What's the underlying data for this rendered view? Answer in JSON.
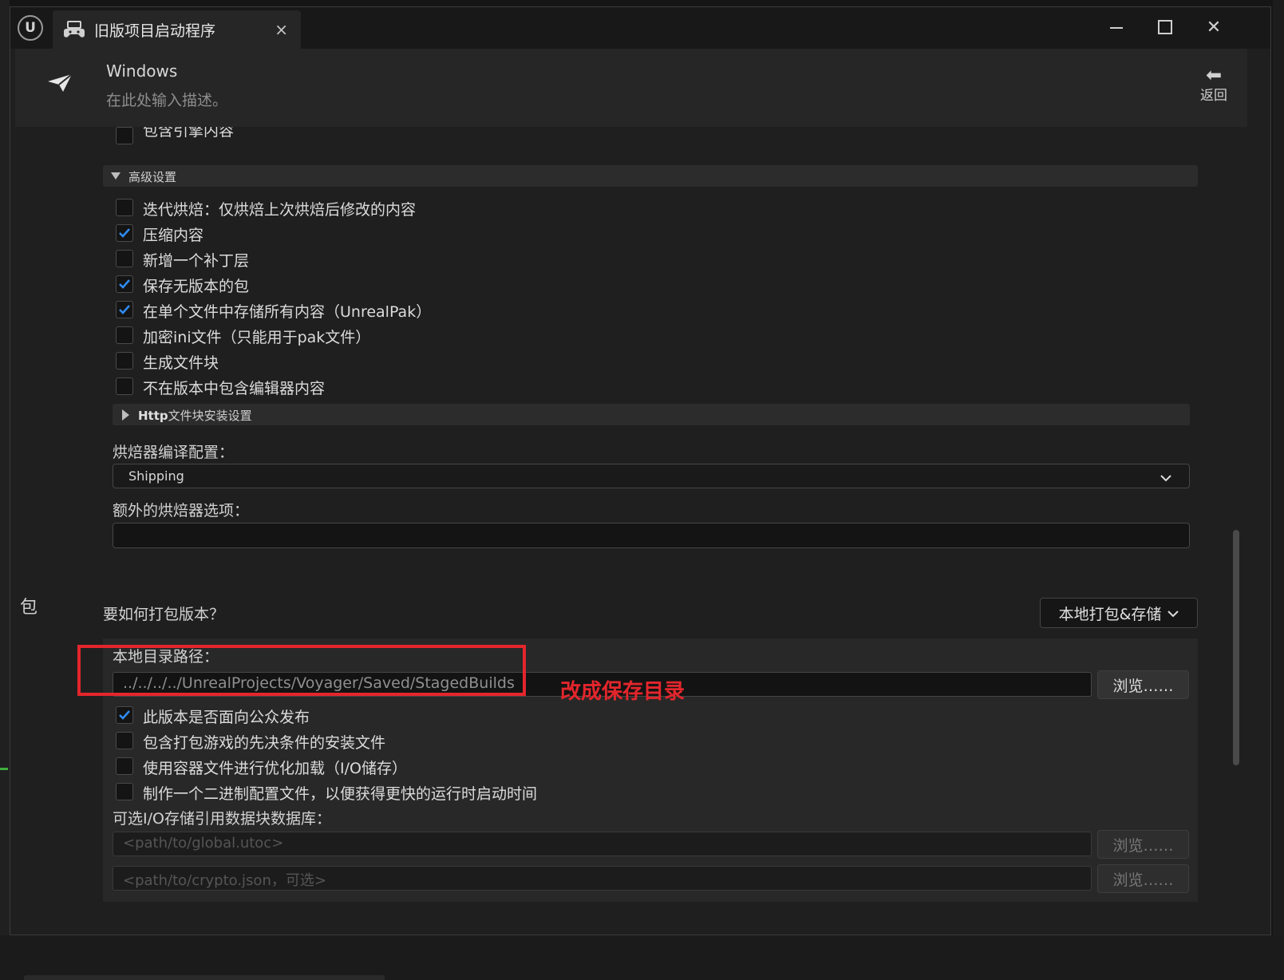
{
  "window": {
    "tab_title": "旧版项目启动程序",
    "tab_close": "×",
    "minimize": "—",
    "maximize": "☐",
    "close": "✕"
  },
  "header": {
    "platform": "Windows",
    "description": "在此处输入描述。",
    "back_label": "返回",
    "back_arrow": "⬅"
  },
  "cook": {
    "partial_item": "包含引擎内容",
    "advanced_label": "高级设置",
    "options": [
      {
        "label": "迭代烘焙：仅烘焙上次烘焙后修改的内容",
        "checked": false
      },
      {
        "label": "压缩内容",
        "checked": true
      },
      {
        "label": "新增一个补丁层",
        "checked": false
      },
      {
        "label": "保存无版本的包",
        "checked": true
      },
      {
        "label": "在单个文件中存储所有内容（UnrealPak）",
        "checked": true
      },
      {
        "label": "加密ini文件（只能用于pak文件）",
        "checked": false
      },
      {
        "label": "生成文件块",
        "checked": false
      },
      {
        "label": "不在版本中包含编辑器内容",
        "checked": false
      }
    ],
    "http_prefix": "Http",
    "http_label": "文件块安装设置",
    "cooker_config_label": "烘焙器编译配置：",
    "cooker_config_value": "Shipping",
    "extra_options_label": "额外的烘焙器选项："
  },
  "package": {
    "side_label": "包",
    "question": "要如何打包版本？",
    "mode": "本地打包&存储",
    "dir_label": "本地目录路径：",
    "dir_value": "../../../../UnrealProjects/Voyager/Saved/StagedBuilds",
    "browse": "浏览……",
    "options": [
      {
        "label": "此版本是否面向公众发布",
        "checked": true
      },
      {
        "label": "包含打包游戏的先决条件的安装文件",
        "checked": false
      },
      {
        "label": "使用容器文件进行优化加载（I/O储存）",
        "checked": false
      },
      {
        "label": "制作一个二进制配置文件，以便获得更快的运行时启动时间",
        "checked": false
      }
    ],
    "io_label": "可选I/O存储引用数据块数据库：",
    "io_placeholder_1": "<path/to/global.utoc>",
    "io_placeholder_2": "<path/to/crypto.json，可选>"
  },
  "annotation": {
    "text": "改成保存目录",
    "color": "#e3262c"
  }
}
